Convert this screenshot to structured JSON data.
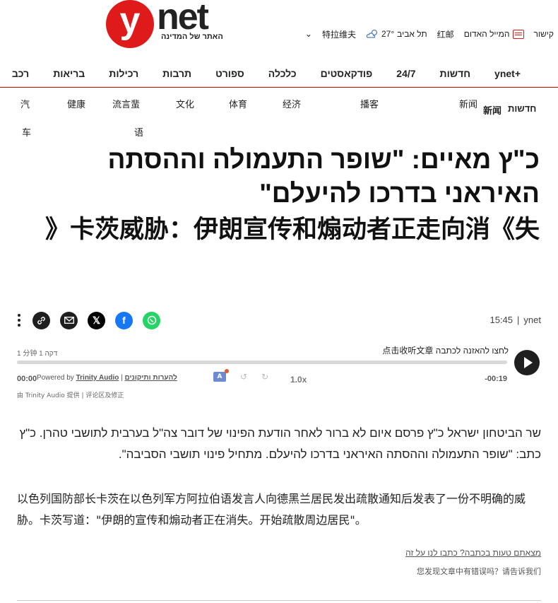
{
  "header": {
    "logo_letter": "y",
    "logo_word": "net",
    "logo_tagline": "האתר של המדינה",
    "top_right": {
      "share": "קישור",
      "mail_label": "המייל האדום",
      "mail_cn": "红邮",
      "weather_city": "תל אביב",
      "weather_temp": "27°",
      "weather_city_cn": "特拉维夫",
      "chevron": "⌄"
    }
  },
  "nav": {
    "items": [
      "ynet+",
      "חדשות",
      "24/7",
      "פודקאסטים",
      "כלכלה",
      "ספורט",
      "תרבות",
      "רכילות",
      "בריאות",
      "רכב"
    ],
    "cn_items": [
      "新闻",
      "播客",
      "经济",
      "体育",
      "文化",
      "流言蜚",
      "健康",
      "汽"
    ],
    "cn_wrap": [
      "车",
      "语"
    ],
    "cn_extra_he": "חדשות",
    "cn_extra": "新闻"
  },
  "article": {
    "title_he": "כ\"ץ מאיים: \"שופר התעמולה וההסתה האיראני בדרכו להיעלם\"",
    "title_cn": "卡茨威胁：伊朗宣传和煽动者正走向消《失《",
    "byline_source": "ynet",
    "byline_time": "15:45",
    "body_he": "שר הביטחון ישראל כ\"ץ פרסם איום לא ברור לאחר הודעת הפינוי של דובר צה\"ל בערבית לתושבי טהרן. כ\"ץ כתב: \"שופר התעמולה וההסתה האיראני בדרכו להיעלם. מתחיל פינוי תושבי הסביבה\".",
    "body_cn": "以色列国防部长卡茨在以色列军方阿拉伯语发言人向德黑兰居民发出疏散通知后发表了一份不明确的威胁。卡茨写道：\"伊朗的宣传和煽动者正在消失。开始疏散周边居民\"。"
  },
  "share": {
    "icons": [
      "more-dots-icon",
      "link-icon",
      "email-icon",
      "x-icon",
      "facebook-icon",
      "whatsapp-icon"
    ],
    "colors": {
      "link": "#1f1f1f",
      "email": "#1f1f1f",
      "x": "#000000",
      "facebook": "#1877f2",
      "whatsapp": "#25d366"
    }
  },
  "audio": {
    "listen_he": "לחצו להאזנה לכתבה",
    "listen_cn": "点击收听文章",
    "duration_he": "1 דקה",
    "duration_cn": "1 分钟",
    "progress": 0,
    "time_left": "00:00",
    "time_right": "-00:19",
    "powered": "Powered by",
    "powered_brand": "Trinity Audio",
    "feedback": "להערות ותיקונים",
    "speed": "1.0x",
    "by_cn": "由 Trinity Audio 提供 | 评论区及修正"
  },
  "footer": {
    "report_he": "מצאתם טעות בכתבה? כתבו לנו על זה",
    "report_cn": "您发现文章中有错误吗？请告诉我们"
  },
  "colors": {
    "brand_red": "#de1a1a",
    "nav_rule": "#cc0000"
  }
}
